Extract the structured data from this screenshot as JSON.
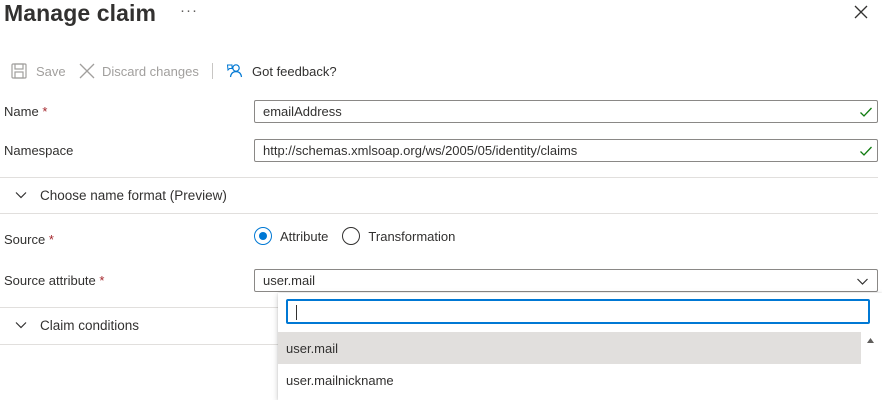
{
  "header": {
    "title": "Manage claim",
    "more": "···"
  },
  "toolbar": {
    "save_label": "Save",
    "discard_label": "Discard changes",
    "feedback_label": "Got feedback?"
  },
  "form": {
    "name": {
      "label": "Name",
      "required": "*",
      "value": "emailAddress"
    },
    "namespace": {
      "label": "Namespace",
      "value": "http://schemas.xmlsoap.org/ws/2005/05/identity/claims"
    },
    "name_format_section": "Choose name format (Preview)",
    "source": {
      "label": "Source",
      "required": "*",
      "options": [
        "Attribute",
        "Transformation"
      ],
      "selected": "Attribute"
    },
    "source_attribute": {
      "label": "Source attribute",
      "required": "*",
      "value": "user.mail"
    },
    "claim_conditions_section": "Claim conditions"
  },
  "dropdown_popup": {
    "search_value": "",
    "options": [
      "user.mail",
      "user.mailnickname"
    ],
    "selected": "user.mail"
  },
  "colors": {
    "accent": "#0078d4",
    "success": "#107c10",
    "required": "#a4262c"
  }
}
